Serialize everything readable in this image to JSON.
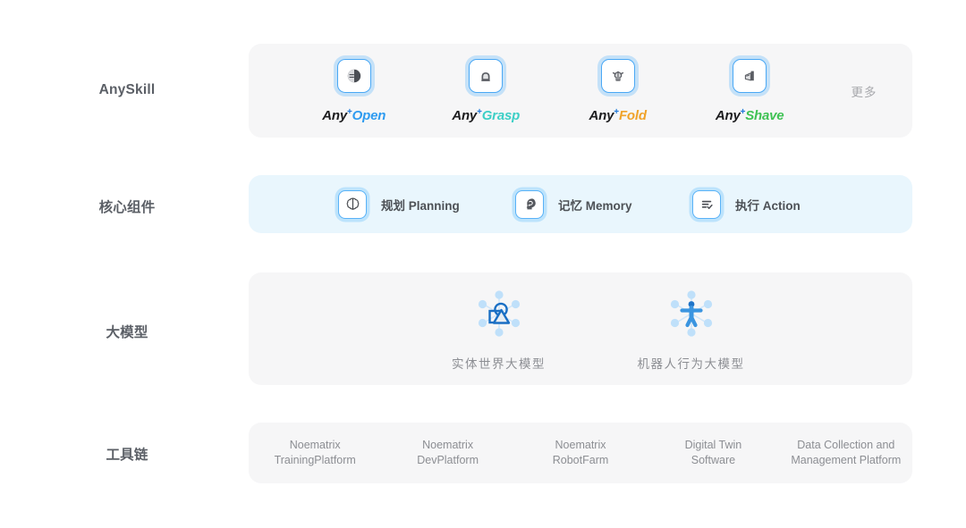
{
  "rows": [
    {
      "label": "AnySkill",
      "panel_color": "#f6f6f7",
      "skills": [
        {
          "prefix": "Any",
          "plus": "+",
          "suffix": "Open",
          "suffix_color": "#2e9bf0",
          "icon": "sphere-shade-icon"
        },
        {
          "prefix": "Any",
          "plus": "+",
          "suffix": "Grasp",
          "suffix_color": "#3ccfc6",
          "icon": "hand-grasp-icon"
        },
        {
          "prefix": "Any",
          "plus": "+",
          "suffix": "Fold",
          "suffix_color": "#f0a32a",
          "icon": "fold-cloth-icon"
        },
        {
          "prefix": "Any",
          "plus": "+",
          "suffix": "Shave",
          "suffix_color": "#3fc254",
          "icon": "shave-razor-icon"
        }
      ],
      "more_label": "更多"
    },
    {
      "label": "核心组件",
      "panel_color": "#e9f6fd",
      "components": [
        {
          "text": "规划 Planning",
          "icon": "brain-icon"
        },
        {
          "text": "记忆 Memory",
          "icon": "head-memory-icon"
        },
        {
          "text": "执行 Action",
          "icon": "checklist-icon"
        }
      ]
    },
    {
      "label": "大模型",
      "panel_color": "#f6f6f7",
      "models": [
        {
          "caption": "实体世界大模型",
          "icon": "world-shapes-node-icon"
        },
        {
          "caption": "机器人行为大模型",
          "icon": "humanoid-node-icon"
        }
      ]
    },
    {
      "label": "工具链",
      "panel_color": "#f6f6f7",
      "tools": [
        {
          "text": "Noematrix\nTrainingPlatform"
        },
        {
          "text": "Noematrix\nDevPlatform"
        },
        {
          "text": "Noematrix\nRobotFarm"
        },
        {
          "text": "Digital Twin\nSoftware"
        },
        {
          "text": "Data Collection and\nManagement Platform"
        }
      ]
    }
  ],
  "colors": {
    "accent_blue": "#1c76d8",
    "tile_border": "#4aa8f5",
    "node_light": "#bfe0fa",
    "node_dark": "#1a6fc4",
    "label_gray": "#5b5f66",
    "muted_gray": "#8c8e93"
  }
}
